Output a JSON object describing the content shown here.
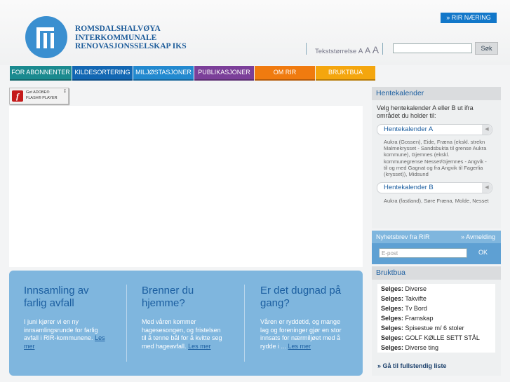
{
  "header": {
    "org_name_lines": [
      "ROMSDALSHALVØYA",
      "INTERKOMMUNALE",
      "RENOVASJONSSELSKAP IKS"
    ],
    "rir_naering": "» RIR NÆRING",
    "text_size_label": "Tekststørrelse",
    "text_size_options": [
      "A",
      "A",
      "A"
    ],
    "search_value": "",
    "search_button": "Søk"
  },
  "nav": {
    "items": [
      {
        "label": "FOR ABONNENTER",
        "color": "#1a8a8f"
      },
      {
        "label": "KILDESORTERING",
        "color": "#1267b3"
      },
      {
        "label": "MILJØSTASJONER",
        "color": "#2289cf"
      },
      {
        "label": "PUBLIKASJONER",
        "color": "#7b3f99"
      },
      {
        "label": "OM RIR",
        "color": "#f07b0f"
      },
      {
        "label": "BRUKTBUA",
        "color": "#f4a60e"
      }
    ]
  },
  "flash": {
    "line1": "Get ADOBE®",
    "line2": "FLASH® PLAYER",
    "icon": "flash-icon"
  },
  "info_panel": {
    "columns": [
      {
        "title": "Innsamling av farlig avfall",
        "text": "I juni kjører vi en ny innsamlingsrunde for farlig avfall i RIR-kommunene.",
        "more": "Les mer"
      },
      {
        "title": "Brenner du hjemme?",
        "text": "Med våren kommer hagesesongen, og fristelsen til å tenne bål for å kvitte seg med hageavfall.",
        "more": "Les mer"
      },
      {
        "title": "Er det dugnad på gang?",
        "text": "Våren er ryddetid, og mange lag og foreninger gjør en stor innsats for nærmiljøet med å rydde i ...",
        "more": "Les mer"
      }
    ]
  },
  "sidebar": {
    "hentekalender": {
      "title": "Hentekalender",
      "intro": "Velg hentekalender A eller B ut ifra området du holder til:",
      "a_label": "Hentekalender A",
      "a_areas": "Aukra (Gossen), Eide, Fræna (ekskl. strekn Malmekrysset - Sandsbukta til grense Aukra kommune), Gjemnes (ekskl. kommunegrense Nesset/Gjemnes - Angvik - til og med Gagnat og fra Angvik til Fagerlia (krysset)), Midsund",
      "b_label": "Hentekalender B",
      "b_areas": "Aukra (fastland), Søre Fræna, Molde, Nesset"
    },
    "newsletter": {
      "title": "Nyhetsbrev fra RIR",
      "unsubscribe": "» Avmelding",
      "email_placeholder": "E-post",
      "ok": "OK"
    },
    "bruktbua": {
      "title": "Bruktbua",
      "prefix": "Selges:",
      "items": [
        "Diverse",
        "Takvifte",
        "Tv Bord",
        "Framskap",
        "Spisestue m/ 6 stoler",
        "GOLF KØLLE SETT STÅL",
        "Diverse ting"
      ],
      "more": "» Gå til fullstendig liste"
    }
  }
}
